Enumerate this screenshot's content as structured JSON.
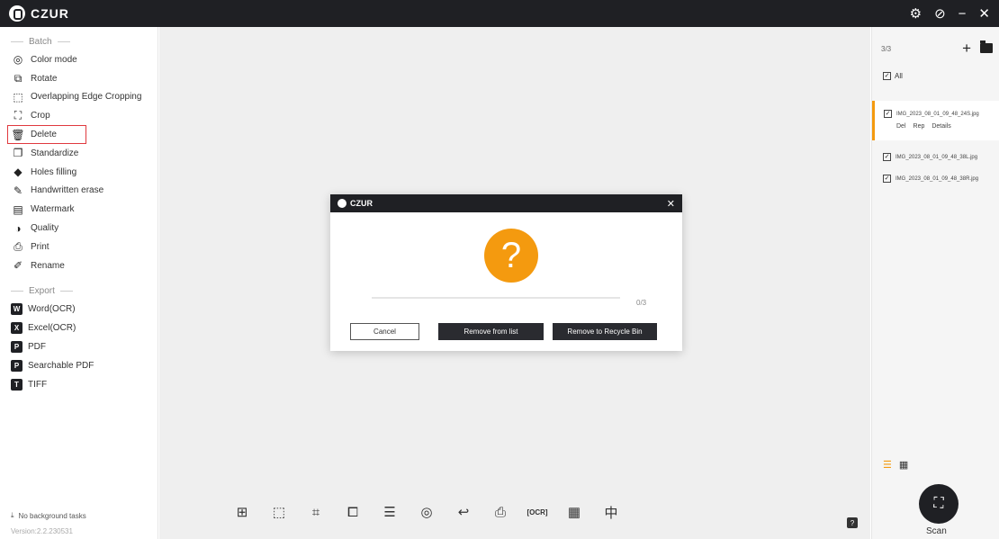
{
  "app": {
    "brand": "CZUR"
  },
  "window_controls": [
    "settings-icon",
    "help-icon",
    "minimize-icon",
    "close-icon"
  ],
  "sidebar": {
    "batch_title": "Batch",
    "batch_items": [
      {
        "label": "Color mode",
        "icon": "color-mode-icon"
      },
      {
        "label": "Rotate",
        "icon": "rotate-icon"
      },
      {
        "label": "Overlapping Edge Cropping",
        "icon": "edge-crop-icon"
      },
      {
        "label": "Crop",
        "icon": "crop-icon"
      },
      {
        "label": "Delete",
        "icon": "delete-icon"
      },
      {
        "label": "Standardize",
        "icon": "standardize-icon"
      },
      {
        "label": "Holes filling",
        "icon": "holes-filling-icon"
      },
      {
        "label": "Handwritten erase",
        "icon": "eraser-icon"
      },
      {
        "label": "Watermark",
        "icon": "watermark-icon"
      },
      {
        "label": "Quality",
        "icon": "quality-icon"
      },
      {
        "label": "Print",
        "icon": "print-icon"
      },
      {
        "label": "Rename",
        "icon": "rename-icon"
      }
    ],
    "export_title": "Export",
    "export_items": [
      {
        "label": "Word(OCR)",
        "badge": "W"
      },
      {
        "label": "Excel(OCR)",
        "badge": "X"
      },
      {
        "label": "PDF",
        "badge": "P"
      },
      {
        "label": "Searchable PDF",
        "badge": "P"
      },
      {
        "label": "TIFF",
        "badge": "T"
      }
    ],
    "tasks": "No background tasks",
    "version": "Version:2.2.230531"
  },
  "toolbar_icons": [
    "split-icon",
    "select-icon",
    "crop-icon",
    "rotate-crop-icon",
    "adjust-icon",
    "color-icon",
    "undo-icon",
    "print-icon",
    "ocr-icon",
    "qr-icon",
    "center-icon"
  ],
  "dialog": {
    "title": "CZUR",
    "progress_value": 0,
    "progress_text": "0/3",
    "cancel": "Cancel",
    "remove_list": "Remove from list",
    "remove_recycle": "Remove to Recycle Bin"
  },
  "right_panel": {
    "count": "3/3",
    "all_label": "All",
    "files": [
      {
        "name": "IMG_2023_08_01_09_48_24S.jpg",
        "active": true
      },
      {
        "name": "IMG_2023_08_01_09_48_38L.jpg",
        "active": false
      },
      {
        "name": "IMG_2023_08_01_09_48_38R.jpg",
        "active": false
      }
    ],
    "file_actions": [
      "Del",
      "Rep",
      "Details"
    ],
    "scan_label": "Scan"
  },
  "colors": {
    "accent": "#f49a0f",
    "dark": "#1f2024",
    "highlight": "#e0393e"
  }
}
